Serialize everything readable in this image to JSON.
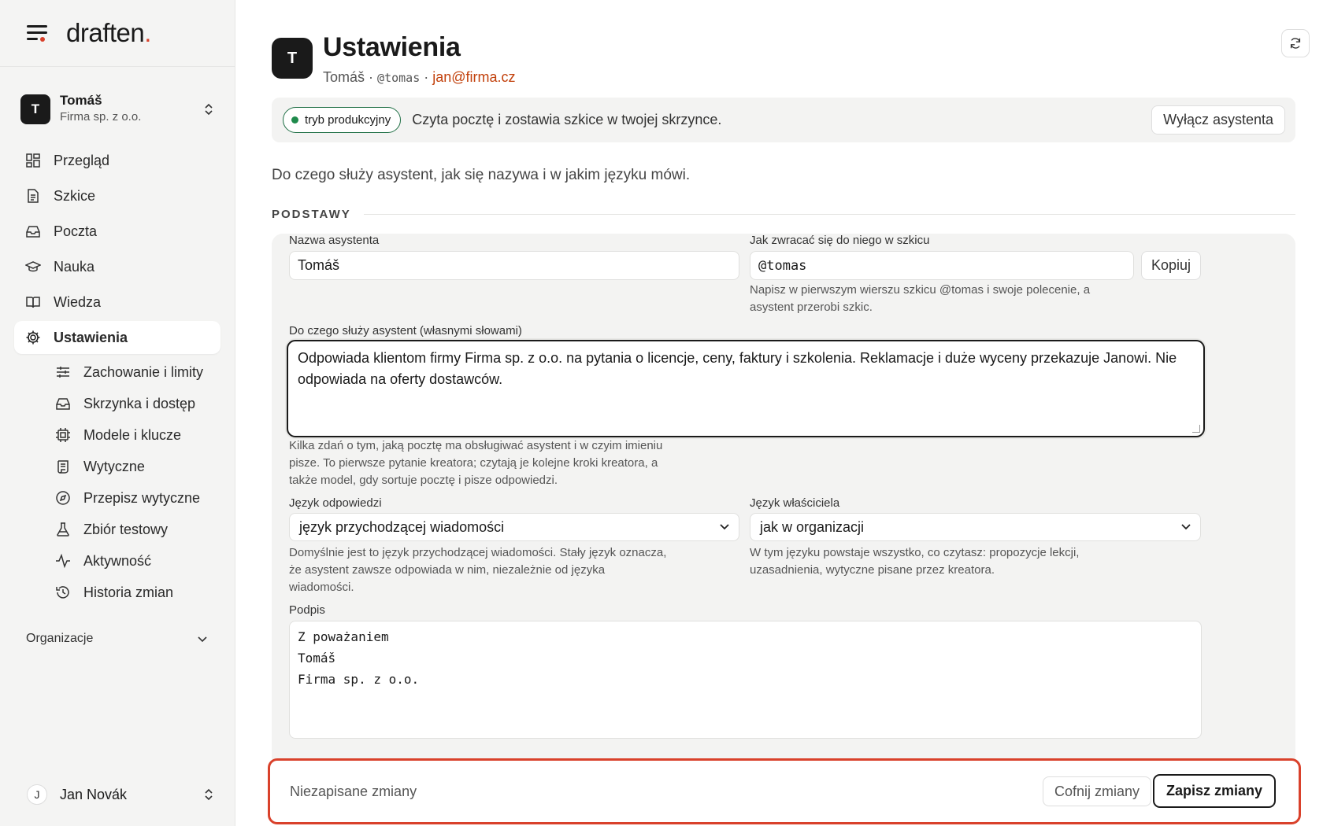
{
  "brand": {
    "logo": "draften",
    "logo_dot": ".",
    "accent_color": "#d9412b"
  },
  "org": {
    "avatar": "T",
    "name": "Tomáš",
    "company": "Firma sp. z o.o."
  },
  "nav": {
    "items": [
      {
        "label": "Przegląd",
        "icon": "grid-icon"
      },
      {
        "label": "Szkice",
        "icon": "document-icon"
      },
      {
        "label": "Poczta",
        "icon": "inbox-icon"
      },
      {
        "label": "Nauka",
        "icon": "graduation-cap-icon"
      },
      {
        "label": "Wiedza",
        "icon": "book-icon"
      },
      {
        "label": "Ustawienia",
        "icon": "gear-icon"
      }
    ],
    "sub_items": [
      {
        "label": "Zachowanie i limity",
        "icon": "sliders-icon"
      },
      {
        "label": "Skrzynka i dostęp",
        "icon": "inbox-icon"
      },
      {
        "label": "Modele i klucze",
        "icon": "chip-icon"
      },
      {
        "label": "Wytyczne",
        "icon": "scroll-icon"
      },
      {
        "label": "Przepisz wytyczne",
        "icon": "compass-icon"
      },
      {
        "label": "Zbiór testowy",
        "icon": "flask-icon"
      },
      {
        "label": "Aktywność",
        "icon": "activity-icon"
      },
      {
        "label": "Historia zmian",
        "icon": "history-icon"
      }
    ],
    "organizations_label": "Organizacje"
  },
  "user": {
    "avatar": "J",
    "name": "Jan Novák"
  },
  "header": {
    "avatar": "T",
    "title": "Ustawienia",
    "name": "Tomáš",
    "separator": "·",
    "handle": "@tomas",
    "email": "jan@firma.cz"
  },
  "prod_bar": {
    "badge": "tryb produkcyjny",
    "text": "Czyta pocztę i zostawia szkice w twojej skrzynce.",
    "disable_label": "Wyłącz asystenta"
  },
  "description": "Do czego służy asystent, jak się nazywa i w jakim języku mówi.",
  "section_title": "PODSTAWY",
  "form": {
    "name_label": "Nazwa asystenta",
    "name_value": "Tomáš",
    "address_label": "Jak zwracać się do niego w szkicu",
    "address_value": "@tomas",
    "copy_label": "Kopiuj",
    "address_hint": "Napisz w pierwszym wierszu szkicu @tomas i swoje polecenie, a asystent przerobi szkic.",
    "purpose_label": "Do czego służy asystent (własnymi słowami)",
    "purpose_value": "Odpowiada klientom firmy Firma sp. z o.o. na pytania o licencje, ceny, faktury i szkolenia. Reklamacje i duże wyceny przekazuje Janowi. Nie odpowiada na oferty dostawców.",
    "purpose_hint": "Kilka zdań o tym, jaką pocztę ma obsługiwać asystent i w czyim imieniu pisze. To pierwsze pytanie kreatora; czytają je kolejne kroki kreatora, a także model, gdy sortuje pocztę i pisze odpowiedzi.",
    "reply_lang_label": "Język odpowiedzi",
    "reply_lang_value": "język przychodzącej wiadomości",
    "reply_lang_hint": "Domyślnie jest to język przychodzącej wiadomości. Stały język oznacza, że asystent zawsze odpowiada w nim, niezależnie od języka wiadomości.",
    "owner_lang_label": "Język właściciela",
    "owner_lang_value": "jak w organizacji",
    "owner_lang_hint": "W tym języku powstaje wszystko, co czytasz: propozycje lekcji, uzasadnienia, wytyczne pisane przez kreatora.",
    "signature_label": "Podpis",
    "signature_value": "Z poważaniem\nTomáš\nFirma sp. z o.o."
  },
  "unsaved": {
    "text": "Niezapisane zmiany",
    "revert_label": "Cofnij zmiany",
    "save_label": "Zapisz zmiany"
  }
}
